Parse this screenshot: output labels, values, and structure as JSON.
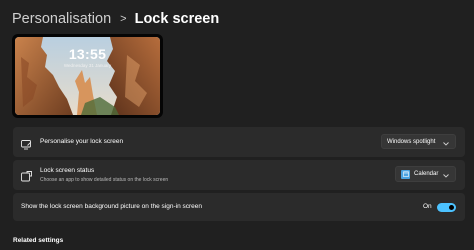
{
  "breadcrumb": {
    "parent": "Personalisation",
    "separator": ">",
    "current": "Lock screen"
  },
  "preview": {
    "time": "13:55",
    "date": "Wednesday 31 January",
    "image": "canyon-rock-spires-wallpaper"
  },
  "settings": {
    "personalise": {
      "icon": "monitor-edit-icon",
      "title": "Personalise your lock screen",
      "value": "Windows spotlight"
    },
    "status": {
      "icon": "status-widget-icon",
      "title": "Lock screen status",
      "subtitle": "Choose an app to show detailed status on the lock screen",
      "value": "Calendar",
      "value_icon": "calendar-app-icon"
    },
    "signin_background": {
      "title": "Show the lock screen background picture on the sign-in screen",
      "state": "On",
      "enabled": true
    }
  },
  "sections": {
    "related": "Related settings"
  },
  "colors": {
    "background": "#202020",
    "card": "#2b2b2b",
    "accent": "#4cc2ff",
    "dropdown": "#363636"
  }
}
